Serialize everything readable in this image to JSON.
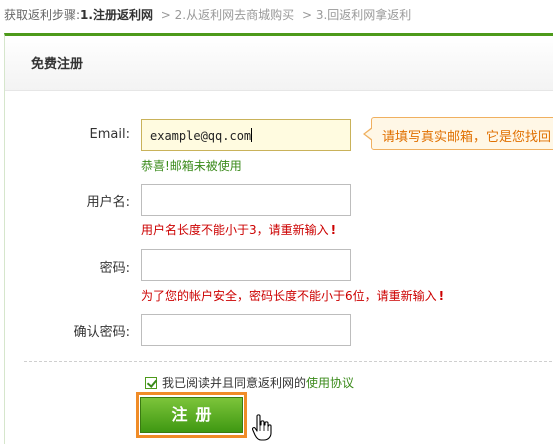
{
  "steps": {
    "lead": "获取返利步骤:",
    "step1": "1.注册返利网",
    "step2": "> 2.从返利网去商城购买",
    "step3": "> 3.回返利网拿返利"
  },
  "panel": {
    "title": "免费注册"
  },
  "form": {
    "email": {
      "label": "Email:",
      "value": "example@qq.com",
      "ok_message": "恭喜!邮箱未被使用"
    },
    "username": {
      "label": "用户名:",
      "value": "",
      "error": "用户名长度不能小于3，请重新输入"
    },
    "password": {
      "label": "密码:",
      "value": "",
      "error": "为了您的帐户安全，密码长度不能小于6位，请重新输入"
    },
    "confirm": {
      "label": "确认密码:",
      "value": ""
    },
    "bang": "!"
  },
  "tooltip": {
    "text": "请填写真实邮箱，它是您找回"
  },
  "agreement": {
    "checked": true,
    "text": "我已阅读并且同意返利网的",
    "link": "使用协议"
  },
  "submit": {
    "label": "注册"
  },
  "colors": {
    "accent": "#4d9a1a",
    "error": "#cc0000",
    "ok": "#3a8a1a",
    "tip": "#e07000",
    "focus_outline": "#f08c28"
  }
}
